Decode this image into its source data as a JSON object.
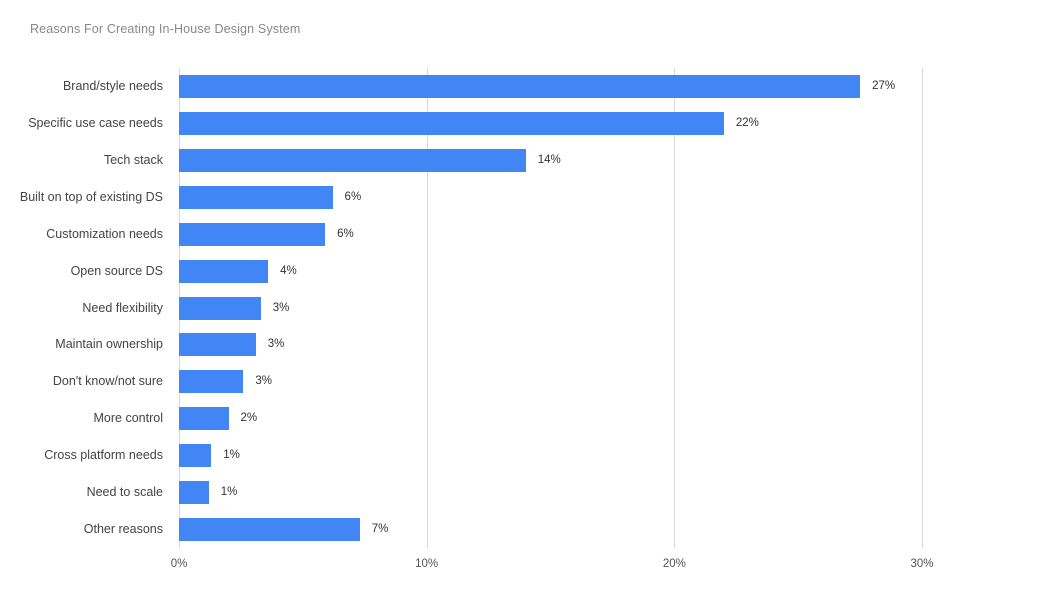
{
  "chart_data": {
    "type": "bar",
    "orientation": "horizontal",
    "title": "Reasons For Creating In-House Design System",
    "xlabel": "",
    "ylabel": "",
    "xlim": [
      0,
      30
    ],
    "x_ticks": [
      "0%",
      "10%",
      "20%",
      "30%"
    ],
    "x_tick_values": [
      0,
      10,
      20,
      30
    ],
    "grid": "vertical",
    "legend": "none",
    "bar_color": "#4285f4",
    "categories": [
      "Brand/style needs",
      "Specific use case needs",
      "Tech stack",
      "Built on top of existing DS",
      "Customization needs",
      "Open source DS",
      "Need flexibility",
      "Maintain ownership",
      "Don't know/not sure",
      "More control",
      "Cross platform needs",
      "Need to scale",
      "Other reasons"
    ],
    "values": [
      27.5,
      22.0,
      14.0,
      6.2,
      5.9,
      3.6,
      3.3,
      3.1,
      2.6,
      2.0,
      1.3,
      1.2,
      7.3
    ],
    "labels": [
      "27%",
      "22%",
      "14%",
      "6%",
      "6%",
      "4%",
      "3%",
      "3%",
      "3%",
      "2%",
      "1%",
      "1%",
      "7%"
    ]
  },
  "colors": {
    "bar": "#4285f4",
    "title_text": "#888888",
    "category_text": "#444444",
    "value_text": "#333333",
    "tick_text": "#555555",
    "gridline": "#d9d9d9",
    "background": "#ffffff"
  }
}
